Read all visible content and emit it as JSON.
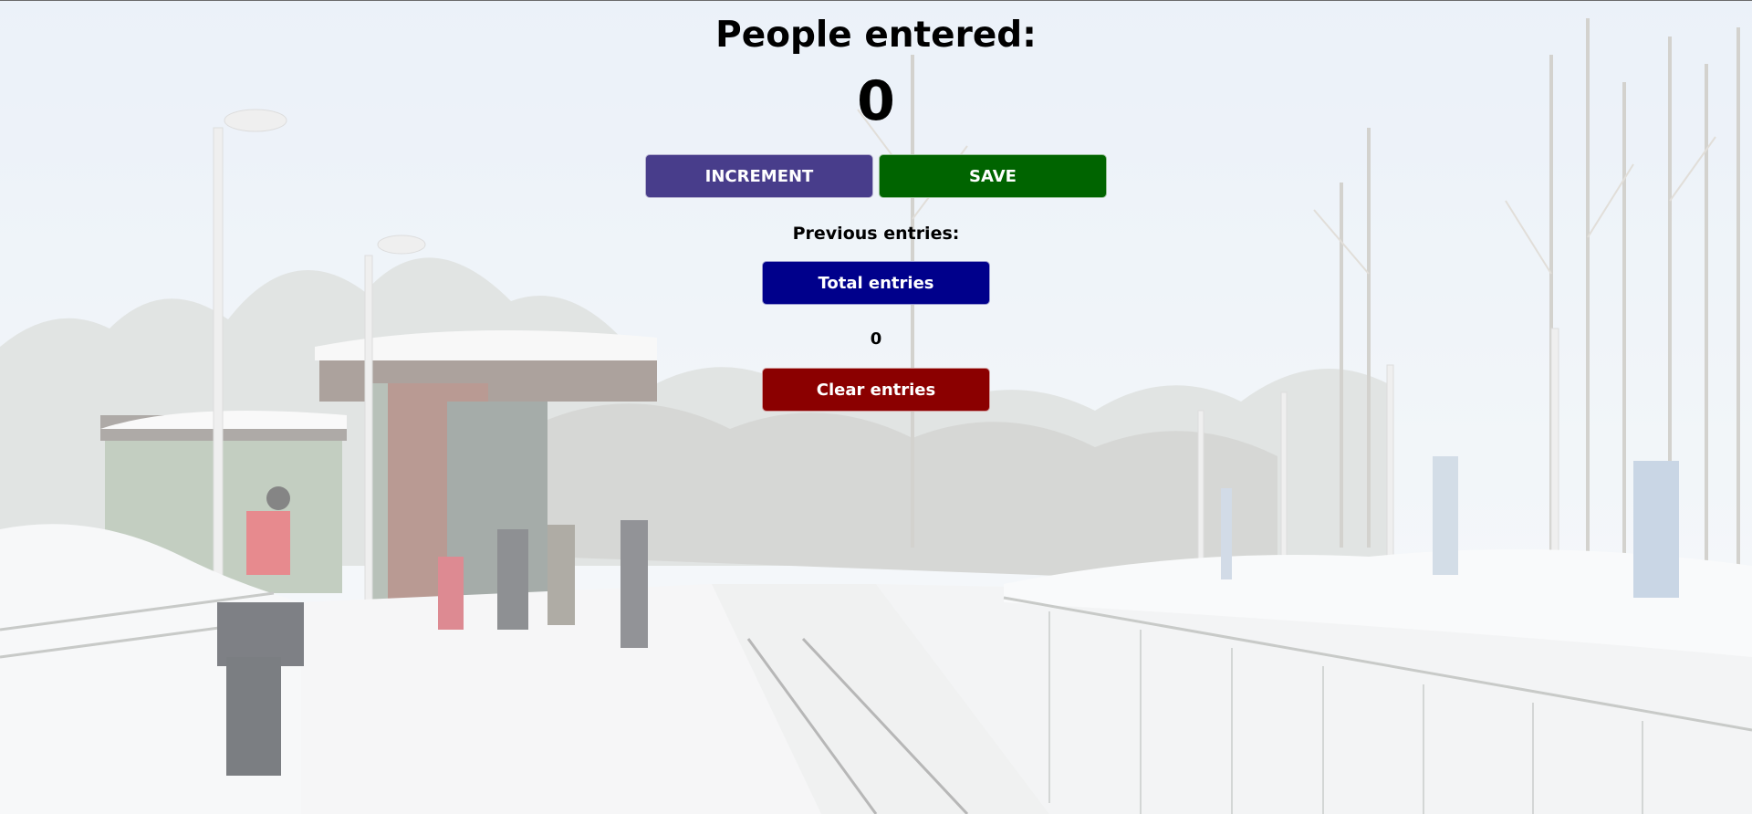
{
  "counter": {
    "title": "People entered:",
    "count": "0"
  },
  "buttons": {
    "increment_label": "INCREMENT",
    "save_label": "SAVE",
    "total_label": "Total entries",
    "clear_label": "Clear entries"
  },
  "history": {
    "label": "Previous entries:",
    "entries": "0"
  },
  "colors": {
    "increment": "#483d8b",
    "save": "#006400",
    "total": "#00008b",
    "clear": "#8b0000"
  }
}
